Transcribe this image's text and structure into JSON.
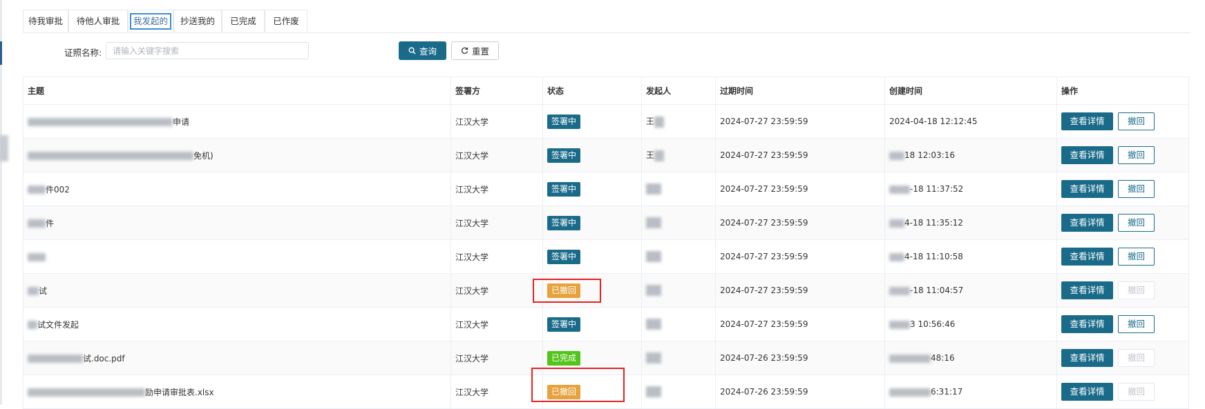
{
  "tabs": [
    "待我审批",
    "待他人审批",
    "我发起的",
    "抄送我的",
    "已完成",
    "已作废"
  ],
  "search": {
    "label": "证照名称:",
    "placeholder": "请输入关键字搜索",
    "value": ""
  },
  "buttons": {
    "query": "查询",
    "reset": "重置"
  },
  "columns": [
    "主题",
    "签署方",
    "状态",
    "发起人",
    "过期时间",
    "创建时间",
    "操作"
  ],
  "rows": [
    {
      "subject": "申请",
      "signer": "江汉大学",
      "status": "签署中",
      "initiator": "王",
      "expire": "2024-07-27 23:59:59",
      "created": "2024-04-18 12:12:45",
      "detail": "查看详情",
      "withdraw": "撤回"
    },
    {
      "subject": "免机)",
      "signer": "江汉大学",
      "status": "签署中",
      "initiator": "王",
      "expire": "2024-07-27 23:59:59",
      "created": "18 12:03:16",
      "detail": "查看详情",
      "withdraw": "撤回"
    },
    {
      "subject": "件002",
      "signer": "江汉大学",
      "status": "签署中",
      "initiator": "",
      "expire": "2024-07-27 23:59:59",
      "created": "-18 11:37:52",
      "detail": "查看详情",
      "withdraw": "撤回"
    },
    {
      "subject": "件",
      "signer": "江汉大学",
      "status": "签署中",
      "initiator": "",
      "expire": "2024-07-27 23:59:59",
      "created": "4-18 11:35:12",
      "detail": "查看详情",
      "withdraw": "撤回"
    },
    {
      "subject": "",
      "signer": "江汉大学",
      "status": "签署中",
      "initiator": "",
      "expire": "2024-07-27 23:59:59",
      "created": "4-18 11:10:58",
      "detail": "查看详情",
      "withdraw": "撤回"
    },
    {
      "subject": "试",
      "signer": "江汉大学",
      "status": "已撤回",
      "initiator": "",
      "expire": "2024-07-27 23:59:59",
      "created": "-18 11:04:57",
      "detail": "查看详情",
      "withdraw": "撤回"
    },
    {
      "subject": "试文件发起",
      "signer": "江汉大学",
      "status": "签署中",
      "initiator": "",
      "expire": "2024-07-27 23:59:59",
      "created": "3 10:56:46",
      "detail": "查看详情",
      "withdraw": "撤回"
    },
    {
      "subject": "试.doc.pdf",
      "signer": "江汉大学",
      "status": "已完成",
      "initiator": "",
      "expire": "2024-07-26 23:59:59",
      "created": "48:16",
      "detail": "查看详情",
      "withdraw": "撤回"
    },
    {
      "subject": "励申请审批表.xlsx",
      "signer": "江汉大学",
      "status": "已撤回",
      "initiator": "",
      "expire": "2024-07-26 23:59:59",
      "created": "6:31:17",
      "detail": "查看详情",
      "withdraw": "撤回"
    }
  ],
  "colors": {
    "primary": "#1a6b8a",
    "withdrawn": "#e6a23c",
    "completed": "#52c41a",
    "highlight": "#e82020"
  },
  "icons": {
    "query": "search-icon",
    "reset": "refresh-icon"
  }
}
